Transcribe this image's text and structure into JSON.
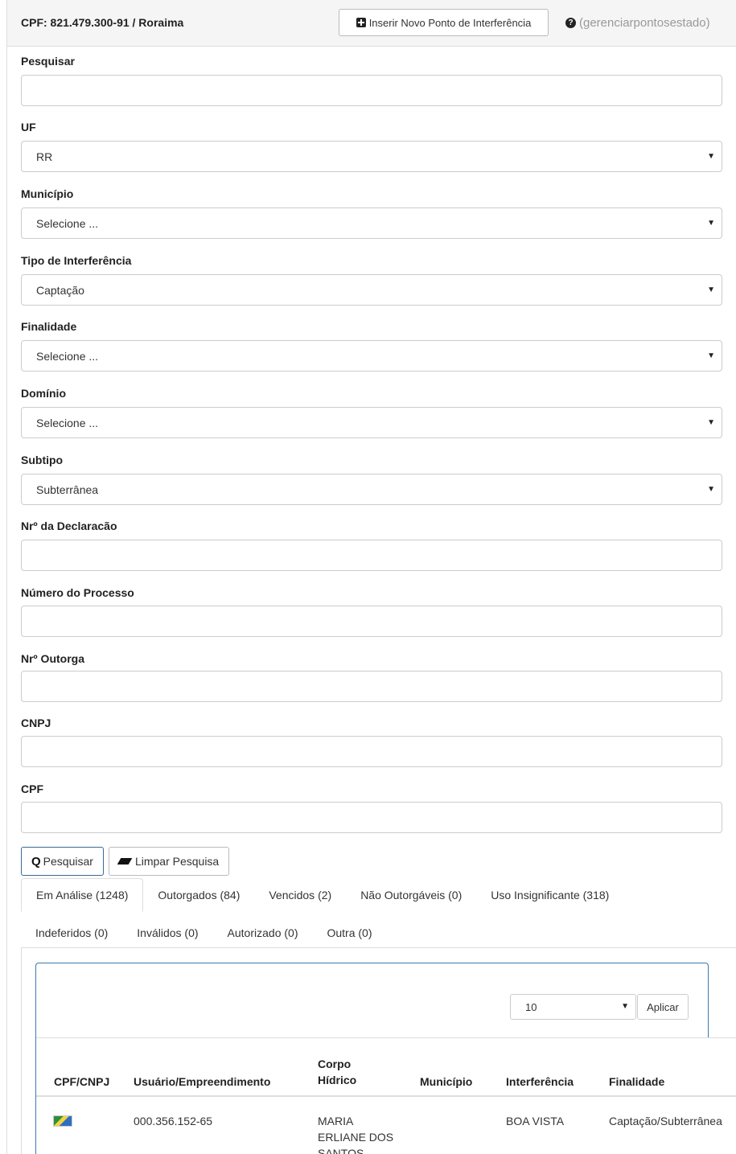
{
  "header": {
    "title": "CPF: 821.479.300-91 / Roraima",
    "insert_button": "Inserir Novo Ponto de Interferência",
    "help_text": "(gerenciarpontosestado)"
  },
  "filters": {
    "pesquisar": {
      "label": "Pesquisar",
      "value": ""
    },
    "uf": {
      "label": "UF",
      "value": "RR"
    },
    "municipio": {
      "label": "Município",
      "value": "Selecione ..."
    },
    "tipo_interferencia": {
      "label": "Tipo de Interferência",
      "value": "Captação"
    },
    "finalidade": {
      "label": "Finalidade",
      "value": "Selecione ..."
    },
    "dominio": {
      "label": "Domínio",
      "value": "Selecione ..."
    },
    "subtipo": {
      "label": "Subtipo",
      "value": "Subterrânea"
    },
    "nr_declaracao": {
      "label": "Nrº da Declaracão",
      "value": ""
    },
    "numero_processo": {
      "label": "Número do Processo",
      "value": ""
    },
    "nr_outorga": {
      "label": "Nrº Outorga",
      "value": ""
    },
    "cnpj": {
      "label": "CNPJ",
      "value": ""
    },
    "cpf": {
      "label": "CPF",
      "value": ""
    }
  },
  "actions": {
    "search": "Pesquisar",
    "clear": "Limpar Pesquisa"
  },
  "tabs": [
    "Em Análise (1248)",
    "Outorgados (84)",
    "Vencidos (2)",
    "Não Outorgáveis (0)",
    "Uso Insignificante (318)",
    "Indeferidos (0)",
    "Inválidos (0)",
    "Autorizado (0)",
    "Outra (0)"
  ],
  "pagination": {
    "page_size": "10",
    "apply": "Aplicar"
  },
  "table": {
    "columns": {
      "cpf_cnpj": "CPF/CNPJ",
      "usuario": "Usuário/Empreendimento",
      "corpo_hidrico_1": "Corpo",
      "corpo_hidrico_2": "Hídrico",
      "municipio": "Município",
      "interferencia": "Interferência",
      "finalidade": "Finalidade"
    },
    "rows": [
      {
        "usuario": "000.356.152-65",
        "corpo_hidrico_1": "MARIA",
        "corpo_hidrico_2": "ERLIANE DOS",
        "corpo_hidrico_3": "SANTOS",
        "municipio": "",
        "interferencia": "BOA VISTA",
        "finalidade": "Captação/Subterrânea"
      }
    ]
  }
}
